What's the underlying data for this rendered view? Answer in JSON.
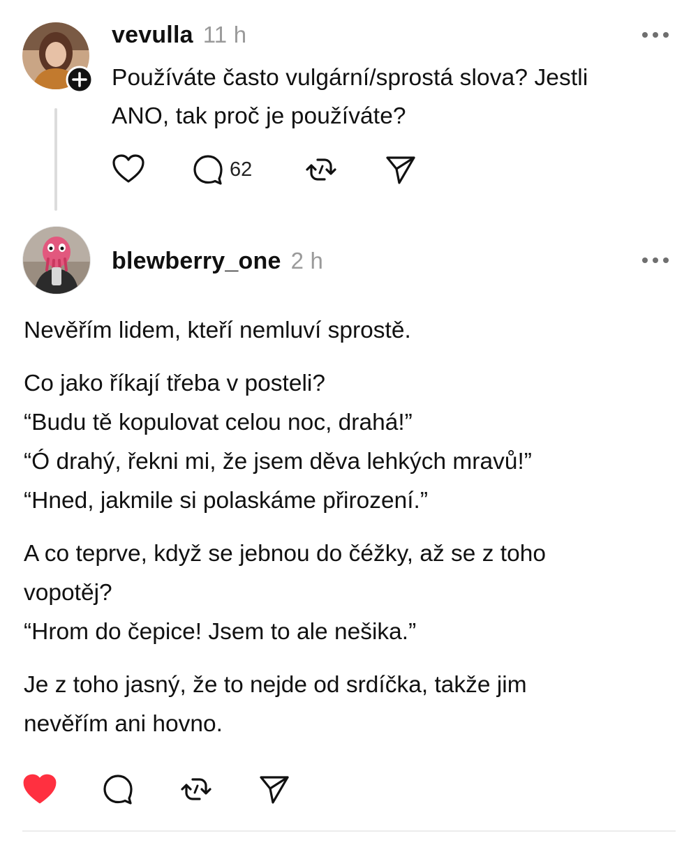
{
  "thread_post": {
    "username": "vevulla",
    "time": "11 h",
    "text_line1": "Používáte často vulgární/sprostá slova? Jestli",
    "text_line2": "ANO, tak proč je používáte?",
    "comment_count": "62",
    "avatar_icon": "profile-photo",
    "follow_icon": "plus-icon"
  },
  "reply_post": {
    "username": "blewberry_one",
    "time": "2 h",
    "paragraphs": [
      [
        "Nevěřím lidem, kteří nemluví sprostě."
      ],
      [
        "Co jako říkají třeba v posteli?",
        "“Budu tě kopulovat celou noc, drahá!”",
        "“Ó drahý, řekni mi, že jsem děva lehkých mravů!”",
        "“Hned, jakmile si polaskáme přirození.”"
      ],
      [
        "A co teprve, když se jebnou do čéžky, až se z toho",
        "vopotěj?",
        "“Hrom do čepice! Jsem to ale nešika.”"
      ],
      [
        "Je z toho jasný, že to nejde od srdíčka, takže jim",
        "nevěřím ani hovno."
      ]
    ],
    "liked": true,
    "like_color": "#ff3040"
  },
  "icons": [
    "heart-icon",
    "comment-icon",
    "repost-icon",
    "share-icon",
    "more-icon"
  ]
}
